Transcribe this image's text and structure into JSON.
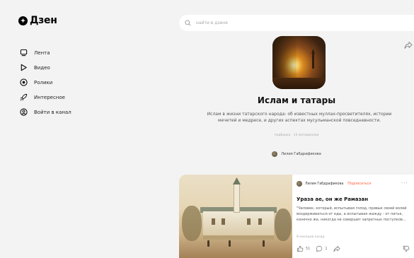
{
  "app": {
    "logo_text": "Дзен"
  },
  "sidebar": {
    "items": [
      {
        "label": "Лента",
        "icon": "feed-icon"
      },
      {
        "label": "Видео",
        "icon": "play-icon"
      },
      {
        "label": "Ролики",
        "icon": "shorts-icon"
      },
      {
        "label": "Интересное",
        "icon": "rocket-icon"
      },
      {
        "label": "Войти в канал",
        "icon": "login-icon"
      }
    ]
  },
  "search": {
    "placeholder": "найти в дзене"
  },
  "collection": {
    "title": "Ислам и татары",
    "description": "Ислам в жизни татарского народа: об известных муллах-просветителях, истории мечетей и медресе, и других аспектах мусульманской повседневности.",
    "meta": "подборка · 13 материалов",
    "author": "Лилия Габдрафикова"
  },
  "article": {
    "author": "Лилия Габдрафикова",
    "subscribe_label": "Подписаться",
    "title": "Ураза ае, он же Рамазан",
    "snippet": "\"Человек, который, испытывая голод, привык своей волей воздерживаться от еды, а испытывая жажду - от питья, конечно же, никогда не совершит запретных поступков...",
    "time": "8 месяцев назад",
    "likes": "51",
    "comments": "1"
  },
  "colors": {
    "accent": "#ff5a36",
    "background": "#f3f3f4"
  }
}
